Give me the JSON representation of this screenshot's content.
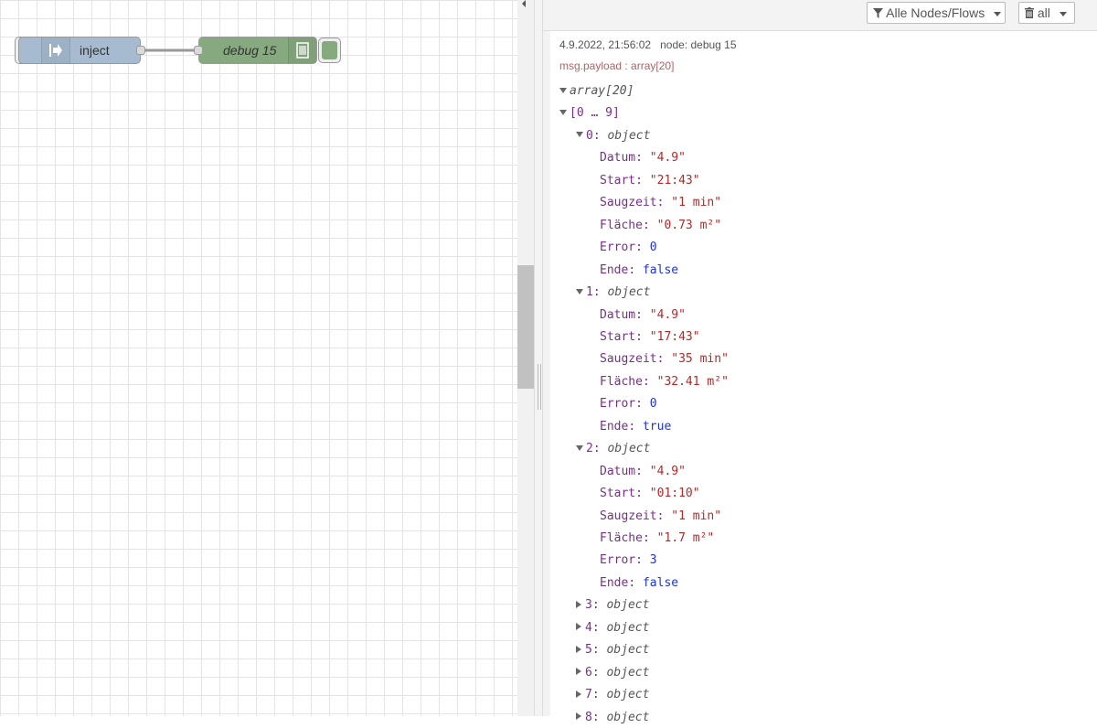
{
  "workspace": {
    "inject_label": "inject",
    "debug_label": "debug 15"
  },
  "toolbar": {
    "filter_label": "Alle Nodes/Flows",
    "clear_label": "all"
  },
  "message": {
    "timestamp": "4.9.2022, 21:56:02",
    "node": "node: debug 15",
    "topic": "msg.payload : array[20]",
    "root_type": "array[20]",
    "range": "[0 … 9]",
    "items": [
      {
        "index": "0",
        "type": "object",
        "expanded": true,
        "fields": [
          {
            "key": "Datum",
            "value": "\"4.9\"",
            "kind": "str"
          },
          {
            "key": "Start",
            "value": "\"21:43\"",
            "kind": "str"
          },
          {
            "key": "Saugzeit",
            "value": "\"1 min\"",
            "kind": "str"
          },
          {
            "key": "Fläche",
            "value": "\"0.73 m²\"",
            "kind": "str"
          },
          {
            "key": "Error",
            "value": "0",
            "kind": "num"
          },
          {
            "key": "Ende",
            "value": "false",
            "kind": "bool"
          }
        ]
      },
      {
        "index": "1",
        "type": "object",
        "expanded": true,
        "fields": [
          {
            "key": "Datum",
            "value": "\"4.9\"",
            "kind": "str"
          },
          {
            "key": "Start",
            "value": "\"17:43\"",
            "kind": "str"
          },
          {
            "key": "Saugzeit",
            "value": "\"35 min\"",
            "kind": "str"
          },
          {
            "key": "Fläche",
            "value": "\"32.41 m²\"",
            "kind": "str"
          },
          {
            "key": "Error",
            "value": "0",
            "kind": "num"
          },
          {
            "key": "Ende",
            "value": "true",
            "kind": "bool"
          }
        ]
      },
      {
        "index": "2",
        "type": "object",
        "expanded": true,
        "fields": [
          {
            "key": "Datum",
            "value": "\"4.9\"",
            "kind": "str"
          },
          {
            "key": "Start",
            "value": "\"01:10\"",
            "kind": "str"
          },
          {
            "key": "Saugzeit",
            "value": "\"1 min\"",
            "kind": "str"
          },
          {
            "key": "Fläche",
            "value": "\"1.7 m²\"",
            "kind": "str"
          },
          {
            "key": "Error",
            "value": "3",
            "kind": "num"
          },
          {
            "key": "Ende",
            "value": "false",
            "kind": "bool"
          }
        ]
      },
      {
        "index": "3",
        "type": "object",
        "expanded": false,
        "fields": []
      },
      {
        "index": "4",
        "type": "object",
        "expanded": false,
        "fields": []
      },
      {
        "index": "5",
        "type": "object",
        "expanded": false,
        "fields": []
      },
      {
        "index": "6",
        "type": "object",
        "expanded": false,
        "fields": []
      },
      {
        "index": "7",
        "type": "object",
        "expanded": false,
        "fields": []
      },
      {
        "index": "8",
        "type": "object",
        "expanded": false,
        "fields": []
      }
    ]
  },
  "colors": {
    "inject_node": "#a6bbcf",
    "debug_node": "#87a980",
    "key": "#792e8a",
    "string": "#b72828",
    "number": "#2033d6"
  }
}
